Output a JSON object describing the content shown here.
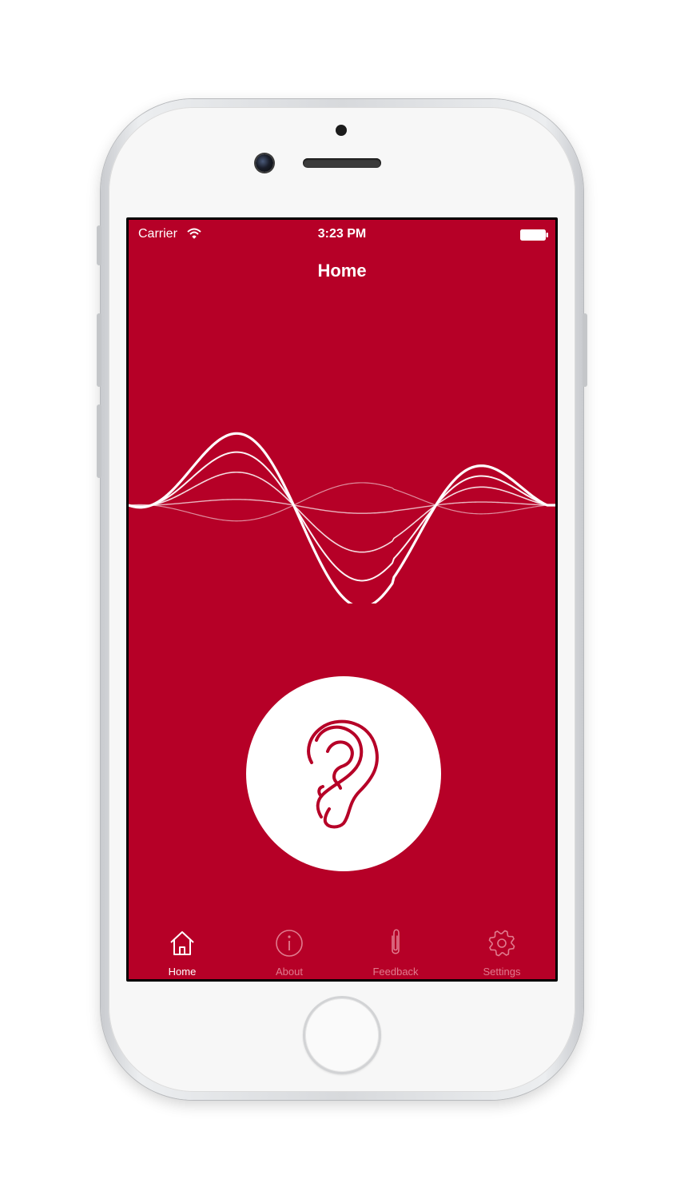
{
  "status_bar": {
    "carrier": "Carrier",
    "time": "3:23 PM",
    "wifi_icon": "wifi-icon",
    "battery_icon": "battery-icon"
  },
  "nav": {
    "title": "Home"
  },
  "visualizer": {
    "icon": "sound-wave",
    "wave_color": "#ffffff"
  },
  "listen_button": {
    "icon": "ear-icon",
    "icon_color": "#b60027"
  },
  "tabs": [
    {
      "label": "Home",
      "icon": "home-icon",
      "active": true
    },
    {
      "label": "About",
      "icon": "info-icon",
      "active": false
    },
    {
      "label": "Feedback",
      "icon": "paperclip-icon",
      "active": false
    },
    {
      "label": "Settings",
      "icon": "gear-icon",
      "active": false
    }
  ],
  "colors": {
    "background": "#b60027",
    "foreground": "#ffffff",
    "tab_inactive": "#e07b8e"
  }
}
